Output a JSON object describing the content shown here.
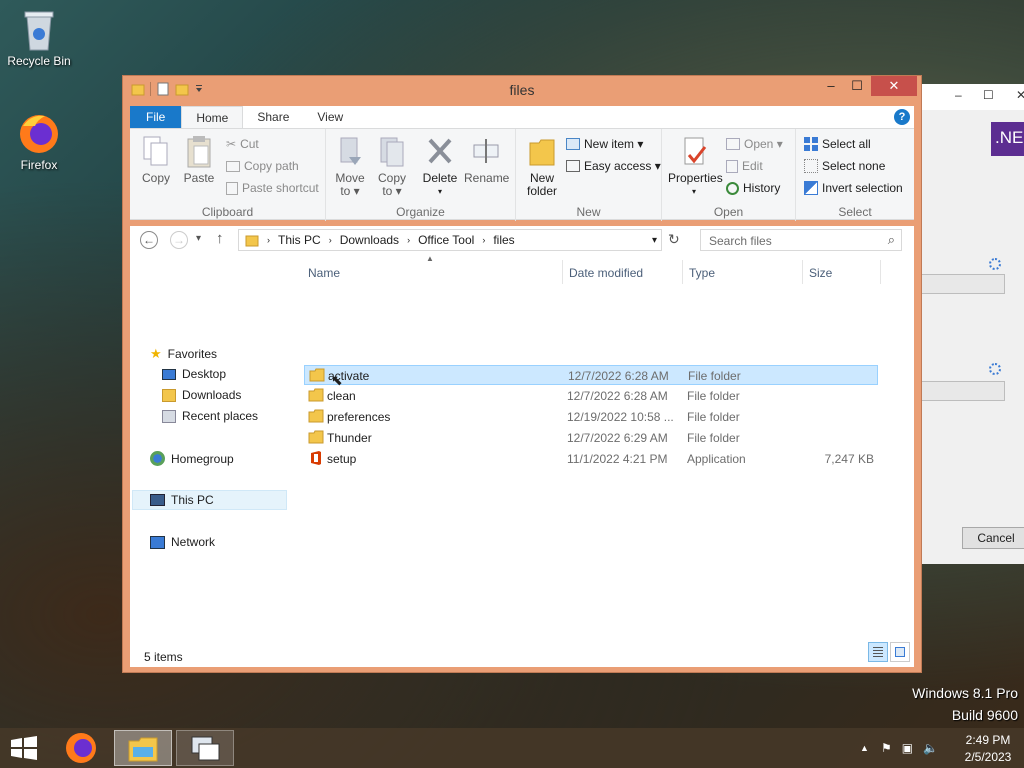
{
  "desktop": {
    "icons": [
      {
        "label": "Recycle Bin"
      },
      {
        "label": "Firefox"
      }
    ],
    "watermark": {
      "line1": "Windows 8.1 Pro",
      "line2": "Build 9600"
    }
  },
  "background_window": {
    "badge": ".NE",
    "cancel_label": "Cancel"
  },
  "window": {
    "title": "files",
    "controls": {
      "minimize": "–",
      "maximize": "☐",
      "close": "✕"
    }
  },
  "ribbon": {
    "tabs": [
      "File",
      "Home",
      "Share",
      "View"
    ],
    "help": "?",
    "groups": {
      "clipboard": {
        "label": "Clipboard",
        "copy": "Copy",
        "paste": "Paste",
        "cut": "Cut",
        "copy_path": "Copy path",
        "paste_shortcut": "Paste shortcut"
      },
      "organize": {
        "label": "Organize",
        "move_to": "Move to ▾",
        "copy_to": "Copy to ▾",
        "delete": "Delete",
        "rename": "Rename"
      },
      "new": {
        "label": "New",
        "new_folder": "New folder",
        "new_item": "New item ▾",
        "easy_access": "Easy access ▾"
      },
      "open": {
        "label": "Open",
        "properties": "Properties",
        "open": "Open ▾",
        "edit": "Edit",
        "history": "History"
      },
      "select": {
        "label": "Select",
        "select_all": "Select all",
        "select_none": "Select none",
        "invert_selection": "Invert selection"
      }
    }
  },
  "navigation": {
    "breadcrumb": [
      "This PC",
      "Downloads",
      "Office Tool",
      "files"
    ],
    "search_placeholder": "Search files"
  },
  "sidebar": {
    "favorites": "Favorites",
    "favorites_items": [
      "Desktop",
      "Downloads",
      "Recent places"
    ],
    "homegroup": "Homegroup",
    "this_pc": "This PC",
    "network": "Network"
  },
  "file_list": {
    "columns": [
      "Name",
      "Date modified",
      "Type",
      "Size"
    ],
    "rows": [
      {
        "name": "activate",
        "date": "12/7/2022 6:28 AM",
        "type": "File folder",
        "size": "",
        "icon": "folder-icon"
      },
      {
        "name": "clean",
        "date": "12/7/2022 6:28 AM",
        "type": "File folder",
        "size": "",
        "icon": "folder-icon"
      },
      {
        "name": "preferences",
        "date": "12/19/2022 10:58 ...",
        "type": "File folder",
        "size": "",
        "icon": "folder-icon"
      },
      {
        "name": "Thunder",
        "date": "12/7/2022 6:29 AM",
        "type": "File folder",
        "size": "",
        "icon": "folder-icon"
      },
      {
        "name": "setup",
        "date": "11/1/2022 4:21 PM",
        "type": "Application",
        "size": "7,247 KB",
        "icon": "office-app-icon"
      }
    ],
    "selected_index": 0
  },
  "status_bar": {
    "items_count": "5 items"
  },
  "taskbar": {
    "time": "2:49 PM",
    "date": "2/5/2023"
  },
  "colors": {
    "accent": "#1979ca",
    "window_frame": "#ea9e75",
    "close": "#c7504b",
    "selection": "#cce8ff"
  }
}
